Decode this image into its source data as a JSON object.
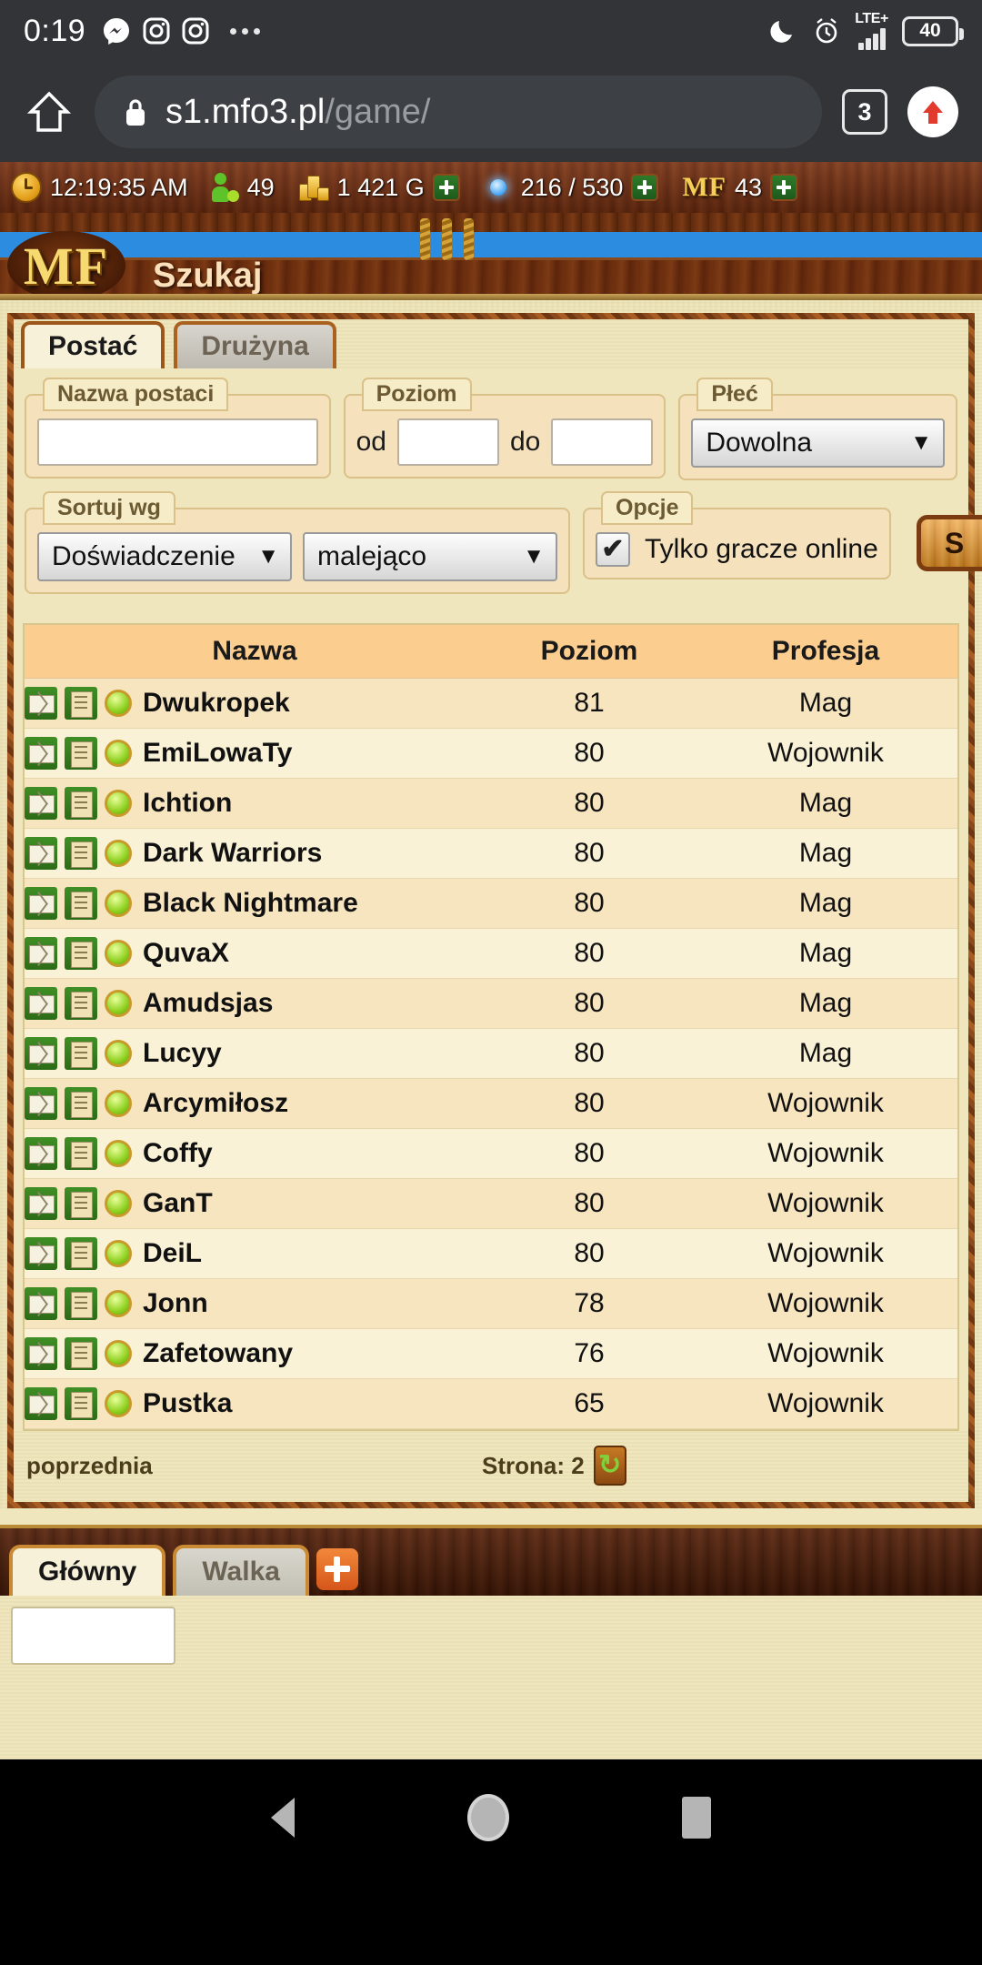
{
  "status_bar": {
    "time": "0:19",
    "left_icons": [
      "messenger-icon",
      "instagram-icon",
      "instagram-icon",
      "overflow-dots-icon"
    ],
    "right_icons": [
      "do-not-disturb-moon-icon",
      "alarm-clock-icon"
    ],
    "network": "LTE+",
    "battery_level": "40"
  },
  "browser": {
    "home_icon": "home-icon",
    "lock_icon": "lock-icon",
    "url_host": "s1.mfo3.pl",
    "url_path": "/game/",
    "tab_count": "3",
    "upload_icon": "upload-arrow-icon"
  },
  "resource_bar": {
    "clock_icon": "clock-icon",
    "clock_value": "12:19:35 AM",
    "players_icon": "players-online-icon",
    "players_value": "49",
    "gold_icon": "gold-coins-icon",
    "gold_value": "1 421 G",
    "gold_add": "add-gold-button",
    "energy_icon": "energy-icon",
    "energy_value": "216 / 530",
    "energy_add": "add-energy-button",
    "mf_label": "MF",
    "mf_value": "43",
    "mf_add": "add-mf-button"
  },
  "banner": {
    "logo": "MF",
    "title": "Szukaj"
  },
  "search_panel": {
    "tabs": [
      {
        "label": "Postać",
        "active": true
      },
      {
        "label": "Drużyna",
        "active": false
      }
    ],
    "name_field": {
      "legend": "Nazwa postaci",
      "value": ""
    },
    "level_field": {
      "legend": "Poziom",
      "from_label": "od",
      "from_value": "",
      "to_label": "do",
      "to_value": ""
    },
    "gender_field": {
      "legend": "Płeć",
      "value": "Dowolna"
    },
    "sort_field": {
      "legend": "Sortuj wg",
      "by_value": "Doświadczenie",
      "dir_value": "malejąco"
    },
    "options_field": {
      "legend": "Opcje",
      "checkbox_label": "Tylko gracze online",
      "checked": true
    },
    "search_button": "S"
  },
  "results": {
    "columns": [
      "Nazwa",
      "Poziom",
      "Profesja"
    ],
    "rows": [
      {
        "name": "Dwukropek",
        "level": "81",
        "profession": "Mag",
        "online": true
      },
      {
        "name": "EmiLowaTy",
        "level": "80",
        "profession": "Wojownik",
        "online": true
      },
      {
        "name": "Ichtion",
        "level": "80",
        "profession": "Mag",
        "online": true
      },
      {
        "name": "Dark Warriors",
        "level": "80",
        "profession": "Mag",
        "online": true
      },
      {
        "name": "Black Nightmare",
        "level": "80",
        "profession": "Mag",
        "online": true
      },
      {
        "name": "QuvaX",
        "level": "80",
        "profession": "Mag",
        "online": true
      },
      {
        "name": "Amudsjas",
        "level": "80",
        "profession": "Mag",
        "online": true
      },
      {
        "name": "Lucyy",
        "level": "80",
        "profession": "Mag",
        "online": true
      },
      {
        "name": "Arcymiłosz",
        "level": "80",
        "profession": "Wojownik",
        "online": true
      },
      {
        "name": "Coffy",
        "level": "80",
        "profession": "Wojownik",
        "online": true
      },
      {
        "name": "GanT",
        "level": "80",
        "profession": "Wojownik",
        "online": true
      },
      {
        "name": "DeiL",
        "level": "80",
        "profession": "Wojownik",
        "online": true
      },
      {
        "name": "Jonn",
        "level": "78",
        "profession": "Wojownik",
        "online": true
      },
      {
        "name": "Zafetowany",
        "level": "76",
        "profession": "Wojownik",
        "online": true
      },
      {
        "name": "Pustka",
        "level": "65",
        "profession": "Wojownik",
        "online": true
      }
    ],
    "pager": {
      "prev_label": "poprzednia",
      "page_label": "Strona: 2",
      "refresh_icon": "refresh-icon"
    }
  },
  "chat": {
    "tabs": [
      {
        "label": "Główny",
        "active": true
      },
      {
        "label": "Walka",
        "active": false
      }
    ],
    "add_tab": "add-chat-tab-button",
    "input_value": ""
  },
  "nav_bar": {
    "back": "back-icon",
    "home": "home-icon",
    "recents": "recents-icon"
  },
  "colors": {
    "wood_dark": "#5d2810",
    "wood_border": "#8a4a1b",
    "parchment": "#efe6bd",
    "row_odd": "#f7e5c0",
    "row_even": "#f9f2d6",
    "header_row": "#fbcd8e",
    "accent_orange": "#e08a20",
    "online_green": "#8ccf1e"
  }
}
